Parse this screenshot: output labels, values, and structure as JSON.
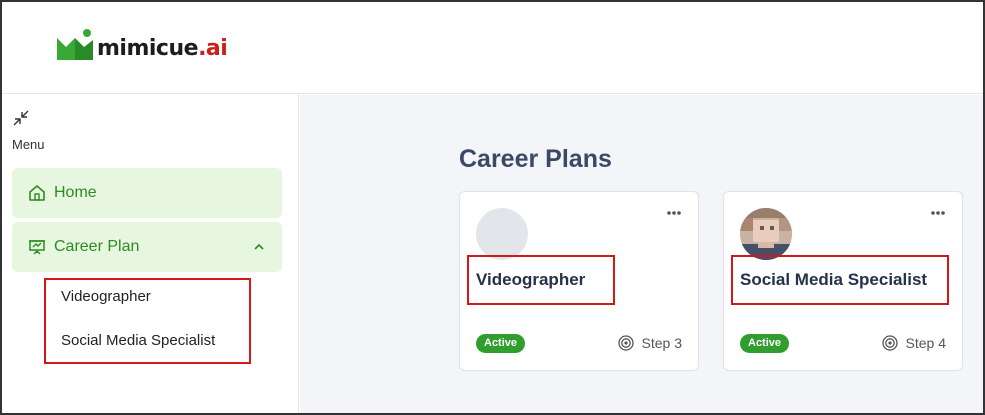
{
  "brand": {
    "name_main": "mimicue",
    "name_suffix": ".ai",
    "accent": "#2e8b22",
    "suffix_color": "#c8201d"
  },
  "sidebar": {
    "menu_label": "Menu",
    "items": [
      {
        "label": "Home",
        "icon": "home-icon"
      },
      {
        "label": "Career Plan",
        "icon": "presentation-icon",
        "expanded": true
      }
    ],
    "submenu": [
      {
        "label": "Videographer"
      },
      {
        "label": "Social Media Specialist"
      }
    ]
  },
  "main": {
    "title": "Career Plans",
    "cards": [
      {
        "title": "Videographer",
        "status": "Active",
        "step": "Step 3",
        "avatar": "placeholder-avatar"
      },
      {
        "title": "Social Media Specialist",
        "status": "Active",
        "step": "Step 4",
        "avatar": "user-photo-avatar"
      }
    ]
  }
}
